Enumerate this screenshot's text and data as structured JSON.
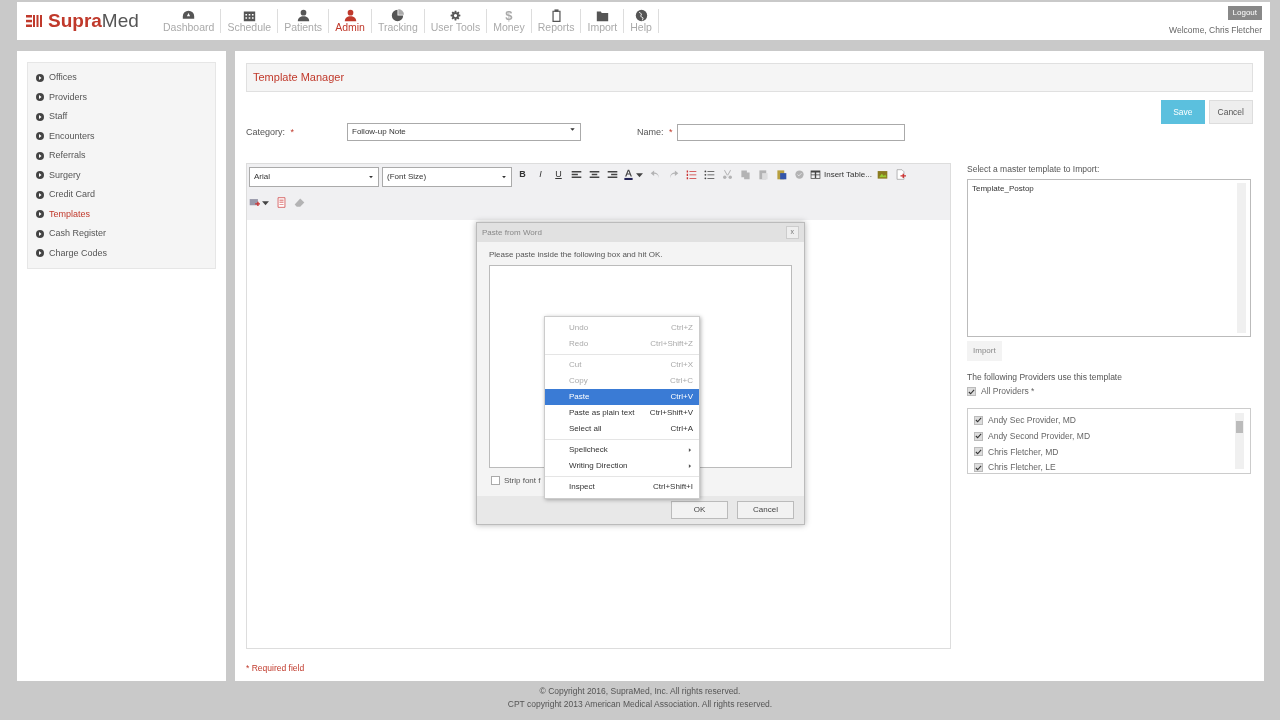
{
  "header": {
    "logo": {
      "first": "Supra",
      "second": "Med"
    },
    "logout": "Logout",
    "welcome": "Welcome, Chris Fletcher"
  },
  "nav": [
    {
      "label": "Dashboard",
      "selected": false
    },
    {
      "label": "Schedule",
      "selected": false
    },
    {
      "label": "Patients",
      "selected": false
    },
    {
      "label": "Admin",
      "selected": true
    },
    {
      "label": "Tracking",
      "selected": false
    },
    {
      "label": "User Tools",
      "selected": false
    },
    {
      "label": "Money",
      "glyph": "$",
      "selected": false
    },
    {
      "label": "Reports",
      "selected": false
    },
    {
      "label": "Import",
      "selected": false
    },
    {
      "label": "Help",
      "selected": false
    }
  ],
  "sidebar": {
    "items": [
      {
        "label": "Offices",
        "selected": false
      },
      {
        "label": "Providers",
        "selected": false
      },
      {
        "label": "Staff",
        "selected": false
      },
      {
        "label": "Encounters",
        "selected": false
      },
      {
        "label": "Referrals",
        "selected": false
      },
      {
        "label": "Surgery",
        "selected": false
      },
      {
        "label": "Credit Card",
        "selected": false
      },
      {
        "label": "Templates",
        "selected": true
      },
      {
        "label": "Cash Register",
        "selected": false
      },
      {
        "label": "Charge Codes",
        "selected": false
      }
    ]
  },
  "page_title": "Template Manager",
  "actions": {
    "save": "Save",
    "cancel": "Cancel"
  },
  "form": {
    "category": {
      "label": "Category:",
      "required": "*",
      "value": "Follow-up Note"
    },
    "name": {
      "label": "Name:",
      "required": "*"
    }
  },
  "editor": {
    "font": "Arial",
    "font_size": "(Font Size)",
    "tools": [
      {
        "kind": "bold",
        "glyph": "B",
        "disabled": false
      },
      {
        "kind": "italic",
        "glyph": "I",
        "disabled": false
      },
      {
        "kind": "underline",
        "glyph": "U",
        "disabled": false
      },
      {
        "kind": "align-left",
        "disabled": false
      },
      {
        "kind": "align-center",
        "disabled": false
      },
      {
        "kind": "align-right",
        "disabled": false
      },
      {
        "kind": "font-color",
        "disabled": false
      },
      {
        "kind": "undo",
        "disabled": true
      },
      {
        "kind": "redo",
        "disabled": true
      },
      {
        "kind": "numbered-list",
        "disabled": false
      },
      {
        "kind": "bullet-list",
        "disabled": false
      },
      {
        "kind": "cut",
        "disabled": true
      },
      {
        "kind": "copy",
        "disabled": true
      },
      {
        "kind": "paste",
        "disabled": true
      },
      {
        "kind": "paste-word",
        "disabled": false
      },
      {
        "kind": "spell",
        "disabled": true
      },
      {
        "kind": "table",
        "label": "Insert Table...",
        "disabled": false
      },
      {
        "kind": "image",
        "disabled": false
      },
      {
        "kind": "new-doc",
        "disabled": false
      },
      {
        "kind": "break"
      },
      {
        "kind": "insert-menu",
        "disabled": false
      },
      {
        "kind": "form-doc",
        "disabled": false
      },
      {
        "kind": "eraser",
        "disabled": true
      }
    ]
  },
  "dialog": {
    "title": "Paste from Word",
    "close": "x",
    "message": "Please paste inside the following box and hit OK.",
    "strip": {
      "label": "Strip font f",
      "checked": false
    },
    "ok": "OK",
    "cancel": "Cancel"
  },
  "context_menu": [
    {
      "kind": "item",
      "label": "Undo",
      "shortcut": "Ctrl+Z",
      "disabled": true,
      "selected": false
    },
    {
      "kind": "item",
      "label": "Redo",
      "shortcut": "Ctrl+Shift+Z",
      "disabled": true,
      "selected": false
    },
    {
      "kind": "separator"
    },
    {
      "kind": "item",
      "label": "Cut",
      "shortcut": "Ctrl+X",
      "disabled": true,
      "selected": false
    },
    {
      "kind": "item",
      "label": "Copy",
      "shortcut": "Ctrl+C",
      "disabled": true,
      "selected": false
    },
    {
      "kind": "item",
      "label": "Paste",
      "shortcut": "Ctrl+V",
      "disabled": false,
      "selected": true
    },
    {
      "kind": "item",
      "label": "Paste as plain text",
      "shortcut": "Ctrl+Shift+V",
      "disabled": false,
      "selected": false
    },
    {
      "kind": "item",
      "label": "Select all",
      "shortcut": "Ctrl+A",
      "disabled": false,
      "selected": false
    },
    {
      "kind": "separator"
    },
    {
      "kind": "submenu",
      "label": "Spellcheck",
      "disabled": false,
      "selected": false
    },
    {
      "kind": "submenu",
      "label": "Writing Direction",
      "disabled": false,
      "selected": false
    },
    {
      "kind": "separator"
    },
    {
      "kind": "item",
      "label": "Inspect",
      "shortcut": "Ctrl+Shift+I",
      "disabled": false,
      "selected": false
    }
  ],
  "import": {
    "label": "Select a master template to Import:",
    "templates": [
      "Template_Postop"
    ],
    "button": "Import",
    "button_disabled": true
  },
  "providers": {
    "label": "The following Providers use this template",
    "all": {
      "label": "All Providers *",
      "checked": true
    },
    "items": [
      {
        "label": "Andy Sec Provider, MD",
        "checked": true
      },
      {
        "label": "Andy Second Provider, MD",
        "checked": true
      },
      {
        "label": "Chris Fletcher, MD",
        "checked": true
      },
      {
        "label": "Chris Fletcher, LE",
        "checked": true
      }
    ]
  },
  "required_note": "* Required field",
  "footer": [
    "© Copyright 2016, SupraMed, Inc. All rights reserved.",
    "CPT copyright 2013 American Medical Association. All rights reserved."
  ]
}
